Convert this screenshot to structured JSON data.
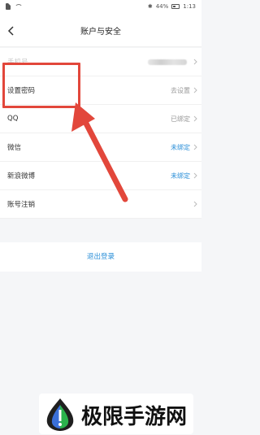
{
  "status_bar": {
    "battery_percent": "44%",
    "time": "1:13"
  },
  "header": {
    "title": "账户与安全"
  },
  "settings": {
    "rows": [
      {
        "label": "手机号",
        "value": ""
      },
      {
        "label": "设置密码",
        "value": "去设置"
      },
      {
        "label": "QQ",
        "value": "已绑定"
      },
      {
        "label": "微信",
        "value": "未绑定"
      },
      {
        "label": "新浪微博",
        "value": "未绑定"
      },
      {
        "label": "账号注销",
        "value": ""
      }
    ]
  },
  "actions": {
    "logout_label": "退出登录"
  },
  "watermark": {
    "text": "极限手游网"
  },
  "colors": {
    "accent": "#2b8fd8",
    "annotation": "#e2473b",
    "muted_text": "#999999"
  }
}
